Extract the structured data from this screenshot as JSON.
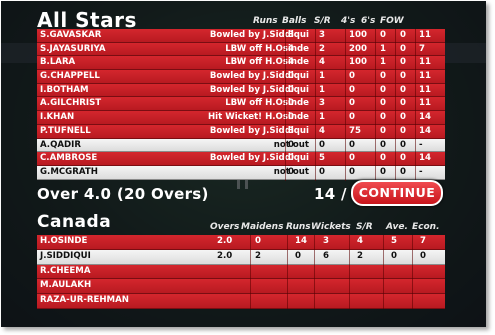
{
  "batting": {
    "team": "All Stars",
    "headers": {
      "runs": "Runs",
      "balls": "Balls",
      "sr": "S/R",
      "fours": "4's",
      "sixes": "6's",
      "fow": "FOW"
    },
    "rows": [
      {
        "name": "S.GAVASKAR",
        "how": "Bowled by J.Siddiqui",
        "r": "3",
        "b": "3",
        "sr": "100",
        "f": "0",
        "s": "0",
        "fow": "11",
        "style": "red"
      },
      {
        "name": "S.JAYASURIYA",
        "how": "LBW off H.Osinde",
        "r": "4",
        "b": "2",
        "sr": "200",
        "f": "1",
        "s": "0",
        "fow": "7",
        "style": "red"
      },
      {
        "name": "B.LARA",
        "how": "LBW off H.Osinde",
        "r": "4",
        "b": "4",
        "sr": "100",
        "f": "1",
        "s": "0",
        "fow": "11",
        "style": "red"
      },
      {
        "name": "G.CHAPPELL",
        "how": "Bowled by J.Siddiqui",
        "r": "0",
        "b": "1",
        "sr": "0",
        "f": "0",
        "s": "0",
        "fow": "11",
        "style": "red"
      },
      {
        "name": "I.BOTHAM",
        "how": "Bowled by J.Siddiqui",
        "r": "0",
        "b": "1",
        "sr": "0",
        "f": "0",
        "s": "0",
        "fow": "11",
        "style": "red"
      },
      {
        "name": "A.GILCHRIST",
        "how": "LBW off H.Osinde",
        "r": "0",
        "b": "3",
        "sr": "0",
        "f": "0",
        "s": "0",
        "fow": "11",
        "style": "red"
      },
      {
        "name": "I.KHAN",
        "how": "Hit Wicket! H.Osinde",
        "r": "0",
        "b": "1",
        "sr": "0",
        "f": "0",
        "s": "0",
        "fow": "14",
        "style": "red"
      },
      {
        "name": "P.TUFNELL",
        "how": "Bowled by J.Siddiqui",
        "r": "3",
        "b": "4",
        "sr": "75",
        "f": "0",
        "s": "0",
        "fow": "14",
        "style": "red"
      },
      {
        "name": "A.QADIR",
        "how": "not out",
        "r": "0",
        "b": "0",
        "sr": "0",
        "f": "0",
        "s": "0",
        "fow": "-",
        "style": "white"
      },
      {
        "name": "C.AMBROSE",
        "how": "Bowled by J.Siddiqui",
        "r": "0",
        "b": "5",
        "sr": "0",
        "f": "0",
        "s": "0",
        "fow": "14",
        "style": "red"
      },
      {
        "name": "G.MCGRATH",
        "how": "not out",
        "r": "0",
        "b": "0",
        "sr": "0",
        "f": "0",
        "s": "0",
        "fow": "-",
        "style": "white"
      }
    ]
  },
  "summary": {
    "over_text": "Over 4.0 (20 Overs)",
    "score": "14 / 9",
    "continue_label": "CONTINUE"
  },
  "bowling": {
    "team": "Canada",
    "headers": {
      "overs": "Overs",
      "maidens": "Maidens",
      "runs": "Runs",
      "wickets": "Wickets",
      "sr": "S/R",
      "ave": "Ave.",
      "econ": "Econ."
    },
    "rows": [
      {
        "name": "H.OSINDE",
        "o": "2.0",
        "m": "0",
        "r": "14",
        "w": "3",
        "sr": "4",
        "ave": "5",
        "ec": "7",
        "style": "red"
      },
      {
        "name": "J.SIDDIQUI",
        "o": "2.0",
        "m": "2",
        "r": "0",
        "w": "6",
        "sr": "2",
        "ave": "0",
        "ec": "0",
        "style": "white"
      },
      {
        "name": "R.CHEEMA",
        "o": "",
        "m": "",
        "r": "",
        "w": "",
        "sr": "",
        "ave": "",
        "ec": "",
        "style": "red"
      },
      {
        "name": "M.AULAKH",
        "o": "",
        "m": "",
        "r": "",
        "w": "",
        "sr": "",
        "ave": "",
        "ec": "",
        "style": "red"
      },
      {
        "name": "RAZA-UR-REHMAN",
        "o": "",
        "m": "",
        "r": "",
        "w": "",
        "sr": "",
        "ave": "",
        "ec": "",
        "style": "red"
      }
    ]
  }
}
